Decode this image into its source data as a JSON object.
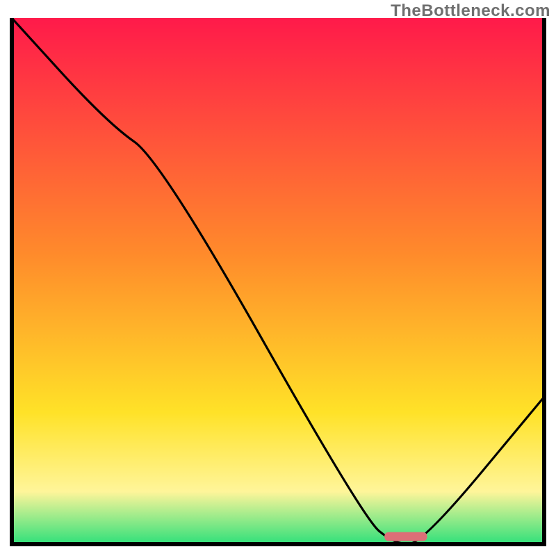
{
  "watermark": "TheBottleneck.com",
  "colors": {
    "frame": "#000000",
    "curve": "#000000",
    "marker": "#dd6f77",
    "grad_top": "#ff1a4a",
    "grad_mid1": "#ff8b2b",
    "grad_mid2": "#ffe228",
    "grad_mid3": "#fff59a",
    "grad_bottom": "#2fe07a"
  },
  "chart_data": {
    "type": "line",
    "title": "",
    "xlabel": "",
    "ylabel": "",
    "xlim": [
      0,
      100
    ],
    "ylim": [
      0,
      100
    ],
    "x": [
      0,
      18,
      28,
      66,
      72,
      77,
      100
    ],
    "values": [
      100,
      80,
      73,
      5,
      0,
      0,
      28
    ],
    "marker": {
      "x_start": 70,
      "x_end": 78,
      "y": 1.5
    }
  }
}
